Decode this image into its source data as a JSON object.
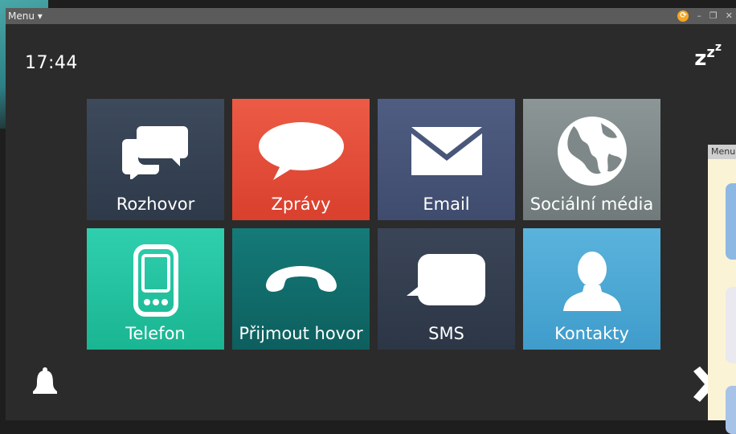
{
  "window": {
    "menu_label": "Menu ▾",
    "controls": {
      "minimize": "–",
      "restore": "❐",
      "close": "✕"
    }
  },
  "clock": "17:44",
  "icons": {
    "sleep": "sleep-icon",
    "bell": "bell-icon",
    "next": "chevron-right-icon",
    "sync": "sync-icon"
  },
  "tiles": [
    {
      "label": "Rozhovor",
      "icon": "chat-bubbles-icon",
      "color": "#36424f"
    },
    {
      "label": "Zprávy",
      "icon": "speech-bubble-icon",
      "color": "#e34c38"
    },
    {
      "label": "Email",
      "icon": "envelope-icon",
      "color": "#475575"
    },
    {
      "label": "Sociální média",
      "icon": "globe-icon",
      "color": "#7e8888"
    },
    {
      "label": "Telefon",
      "icon": "mobile-phone-icon",
      "color": "#25c2a0"
    },
    {
      "label": "Přijmout hovor",
      "icon": "phone-handset-icon",
      "color": "#106c6b"
    },
    {
      "label": "SMS",
      "icon": "sms-bubble-icon",
      "color": "#333e4f"
    },
    {
      "label": "Kontakty",
      "icon": "contact-person-icon",
      "color": "#4ea8d4"
    }
  ],
  "second_window": {
    "menu_label": "Menu"
  }
}
